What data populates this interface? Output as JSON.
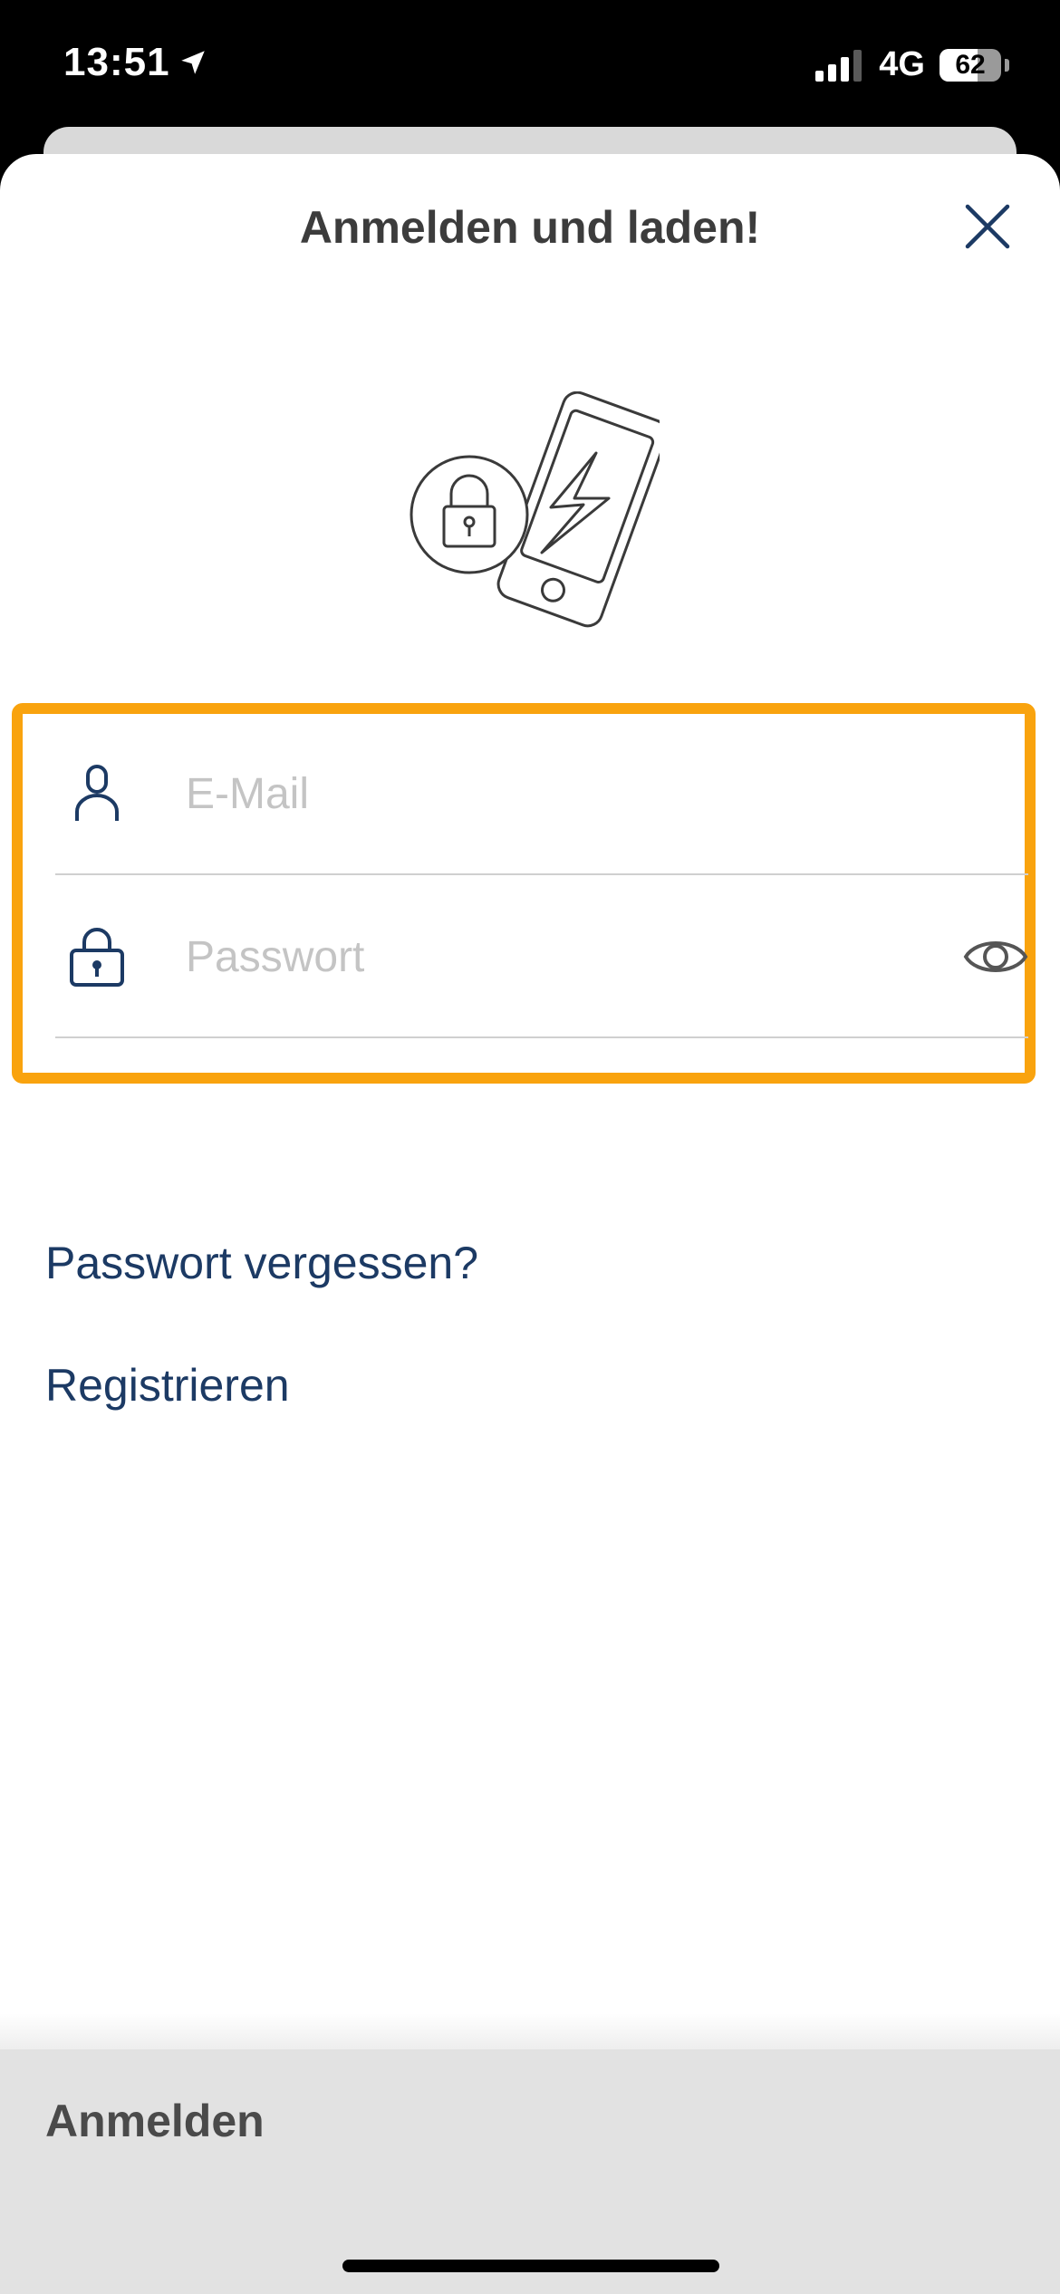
{
  "status_bar": {
    "time": "13:51",
    "network": "4G",
    "battery_percent": "62",
    "battery_level": 0.62
  },
  "sheet": {
    "title": "Anmelden und laden!",
    "close_icon": "close-x-icon",
    "illustration_icon": "phone-lock-charging-icon"
  },
  "form": {
    "email": {
      "placeholder": "E-Mail",
      "value": "",
      "icon": "user-icon"
    },
    "password": {
      "placeholder": "Passwort",
      "value": "",
      "icon": "lock-icon",
      "toggle_icon": "eye-icon"
    },
    "highlight_color": "#f9a30e"
  },
  "links": {
    "forgot_password": "Passwort vergessen?",
    "register": "Registrieren",
    "link_color": "#1c3a64"
  },
  "footer": {
    "login_button": "Anmelden"
  }
}
